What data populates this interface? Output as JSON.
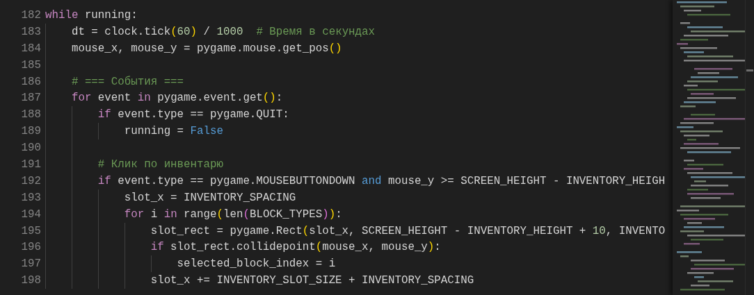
{
  "editor": {
    "lines": [
      {
        "number": "182",
        "tokens": [
          {
            "kind": "keyword",
            "text": "while"
          },
          {
            "kind": "plain",
            "text": " running:"
          }
        ]
      },
      {
        "number": "183",
        "tokens": [
          {
            "kind": "plain",
            "text": "    dt = clock.tick"
          },
          {
            "kind": "bracket1",
            "text": "("
          },
          {
            "kind": "number",
            "text": "60"
          },
          {
            "kind": "bracket1",
            "text": ")"
          },
          {
            "kind": "plain",
            "text": " / "
          },
          {
            "kind": "number",
            "text": "1000"
          },
          {
            "kind": "comment",
            "text": "  # Время в секундах"
          }
        ]
      },
      {
        "number": "184",
        "tokens": [
          {
            "kind": "plain",
            "text": "    mouse_x, mouse_y = pygame.mouse.get_pos"
          },
          {
            "kind": "bracket1",
            "text": "()"
          }
        ]
      },
      {
        "number": "185"
      },
      {
        "number": "186",
        "tokens": [
          {
            "kind": "comment",
            "text": "    # === События ==="
          }
        ]
      },
      {
        "number": "187",
        "tokens": [
          {
            "kind": "keyword",
            "text": "    for"
          },
          {
            "kind": "plain",
            "text": " event "
          },
          {
            "kind": "keyword",
            "text": "in"
          },
          {
            "kind": "plain",
            "text": " pygame.event.get"
          },
          {
            "kind": "bracket1",
            "text": "()"
          },
          {
            "kind": "plain",
            "text": ":"
          }
        ]
      },
      {
        "number": "188",
        "tokens": [
          {
            "kind": "keyword",
            "text": "        if"
          },
          {
            "kind": "plain",
            "text": " event.type == pygame.QUIT:"
          }
        ]
      },
      {
        "number": "189",
        "tokens": [
          {
            "kind": "plain",
            "text": "            running = "
          },
          {
            "kind": "constant",
            "text": "False"
          }
        ]
      },
      {
        "number": "190"
      },
      {
        "number": "191",
        "tokens": [
          {
            "kind": "comment",
            "text": "        # Клик по инвентарю"
          }
        ]
      },
      {
        "number": "192",
        "tokens": [
          {
            "kind": "keyword",
            "text": "        if"
          },
          {
            "kind": "plain",
            "text": " event.type == pygame.MOUSEBUTTONDOWN "
          },
          {
            "kind": "constant",
            "text": "and"
          },
          {
            "kind": "plain",
            "text": " mouse_y >= SCREEN_HEIGHT - INVENTORY_HEIGH"
          }
        ]
      },
      {
        "number": "193",
        "tokens": [
          {
            "kind": "plain",
            "text": "            slot_x = INVENTORY_SPACING"
          }
        ]
      },
      {
        "number": "194",
        "tokens": [
          {
            "kind": "keyword",
            "text": "            for"
          },
          {
            "kind": "plain",
            "text": " i "
          },
          {
            "kind": "keyword",
            "text": "in"
          },
          {
            "kind": "plain",
            "text": " range"
          },
          {
            "kind": "bracket1",
            "text": "("
          },
          {
            "kind": "plain",
            "text": "len"
          },
          {
            "kind": "bracket2",
            "text": "("
          },
          {
            "kind": "plain",
            "text": "BLOCK_TYPES"
          },
          {
            "kind": "bracket2",
            "text": ")"
          },
          {
            "kind": "bracket1",
            "text": ")"
          },
          {
            "kind": "plain",
            "text": ":"
          }
        ]
      },
      {
        "number": "195",
        "tokens": [
          {
            "kind": "plain",
            "text": "                slot_rect = pygame.Rect"
          },
          {
            "kind": "bracket1",
            "text": "("
          },
          {
            "kind": "plain",
            "text": "slot_x, SCREEN_HEIGHT - INVENTORY_HEIGHT + "
          },
          {
            "kind": "number",
            "text": "10"
          },
          {
            "kind": "plain",
            "text": ", INVENTO"
          }
        ]
      },
      {
        "number": "196",
        "tokens": [
          {
            "kind": "keyword",
            "text": "                if"
          },
          {
            "kind": "plain",
            "text": " slot_rect.collidepoint"
          },
          {
            "kind": "bracket1",
            "text": "("
          },
          {
            "kind": "plain",
            "text": "mouse_x, mouse_y"
          },
          {
            "kind": "bracket1",
            "text": ")"
          },
          {
            "kind": "plain",
            "text": ":"
          }
        ]
      },
      {
        "number": "197",
        "tokens": [
          {
            "kind": "plain",
            "text": "                    selected_block_index = i"
          }
        ]
      },
      {
        "number": "198",
        "tokens": [
          {
            "kind": "plain",
            "text": "                slot_x += INVENTORY_SLOT_SIZE + INVENTORY_SPACING"
          }
        ]
      }
    ]
  }
}
